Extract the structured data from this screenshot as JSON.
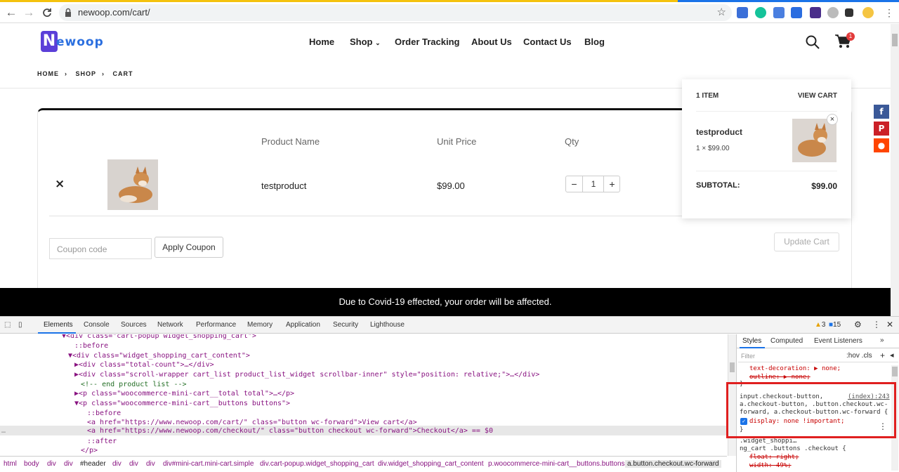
{
  "browser": {
    "url": "newoop.com/cart/",
    "back": "←",
    "forward": "→",
    "reload": "C"
  },
  "site": {
    "logo_letter": "N",
    "logo_text": "ewoop",
    "menu": [
      "Home",
      "Shop",
      "Order Tracking",
      "About Us",
      "Contact Us",
      "Blog"
    ],
    "cart_count": "1",
    "breadcrumb": [
      "HOME",
      "SHOP",
      "CART"
    ]
  },
  "cart": {
    "headers": {
      "product": "Product Name",
      "price": "Unit Price",
      "qty": "Qty"
    },
    "row": {
      "name": "testproduct",
      "price": "$99.00",
      "qty": "1",
      "remove": "×",
      "minus": "−",
      "plus": "+"
    },
    "coupon_placeholder": "Coupon code",
    "apply_label": "Apply Coupon",
    "update_label": "Update Cart"
  },
  "minicart": {
    "count": "1 ITEM",
    "view": "VIEW CART",
    "name": "testproduct",
    "qty_price": "1 × $99.00",
    "subtotal_label": "SUBTOTAL:",
    "subtotal": "$99.00",
    "close": "×"
  },
  "notice": "Due to Covid-19 effected, your order will be affected.",
  "devtools": {
    "tabs": [
      "Elements",
      "Console",
      "Sources",
      "Network",
      "Performance",
      "Memory",
      "Application",
      "Security",
      "Lighthouse"
    ],
    "warnings": "3",
    "messages": "15",
    "styles_tabs": [
      "Styles",
      "Computed",
      "Event Listeners"
    ],
    "filter_placeholder": "Filter",
    "hov_cls": ":hov .cls",
    "dom_lines": [
      "▼<div class=\"cart-popup widget_shopping_cart\">",
      "::before",
      "▼<div class=\"widget_shopping_cart_content\">",
      "▶<div class=\"total-count\">…</div>",
      "▶<div class=\"scroll-wrapper cart_list product_list_widget scrollbar-inner\" style=\"position: relative;\">…</div>",
      "<!-- end product list -->",
      "▶<p class=\"woocommerce-mini-cart__total total\">…</p>",
      "▼<p class=\"woocommerce-mini-cart__buttons buttons\">",
      "::before",
      "<a href=\"https://www.newoop.com/cart/\" class=\"button wc-forward\">View cart</a>",
      "<a href=\"https://www.newoop.com/checkout/\" class=\"button checkout wc-forward\">Checkout</a> == $0",
      "::after",
      "</p>"
    ],
    "breadcrumbs": [
      "html",
      "body",
      "div",
      "div",
      "#header",
      "div",
      "div",
      "div",
      "div#mini-cart.mini-cart.simple",
      "div.cart-popup.widget_shopping_cart",
      "div.widget_shopping_cart_content",
      "p.woocommerce-mini-cart__buttons.buttons",
      "a.button.checkout.wc-forward"
    ],
    "style_lines": [
      "text-decoration: ▶ none;",
      "outline: ▶ none;",
      "}",
      "input.checkout-button,",
      "(index):243",
      "a.checkout-button, .button.checkout.wc-",
      "forward, a.checkout-button.wc-forward {",
      "display: none !important;",
      "}",
      ".widget_shoppi…",
      "ng_cart .buttons .checkout {",
      "float: right;",
      "width: 49%;"
    ]
  }
}
